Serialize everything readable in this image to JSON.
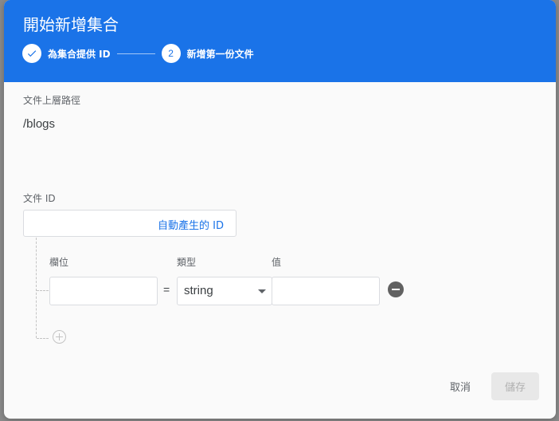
{
  "dialog": {
    "title": "開始新增集合",
    "header_color": "#1a73e8"
  },
  "stepper": {
    "steps": [
      {
        "indicator": "check-icon",
        "label": "為集合提供 ID",
        "status": "completed"
      },
      {
        "indicator": "2",
        "label": "新增第一份文件",
        "status": "active"
      }
    ]
  },
  "parent_path": {
    "label": "文件上層路徑",
    "value": "/blogs"
  },
  "document_id": {
    "label": "文件 ID",
    "value": "",
    "auto_id_label": "自動產生的 ID"
  },
  "fields": {
    "column_labels": {
      "field": "欄位",
      "type": "類型",
      "value": "值"
    },
    "rows": [
      {
        "field": "",
        "equals": "=",
        "type": "string",
        "value": ""
      }
    ]
  },
  "actions": {
    "cancel_label": "取消",
    "save_label": "儲存",
    "save_enabled": false
  }
}
